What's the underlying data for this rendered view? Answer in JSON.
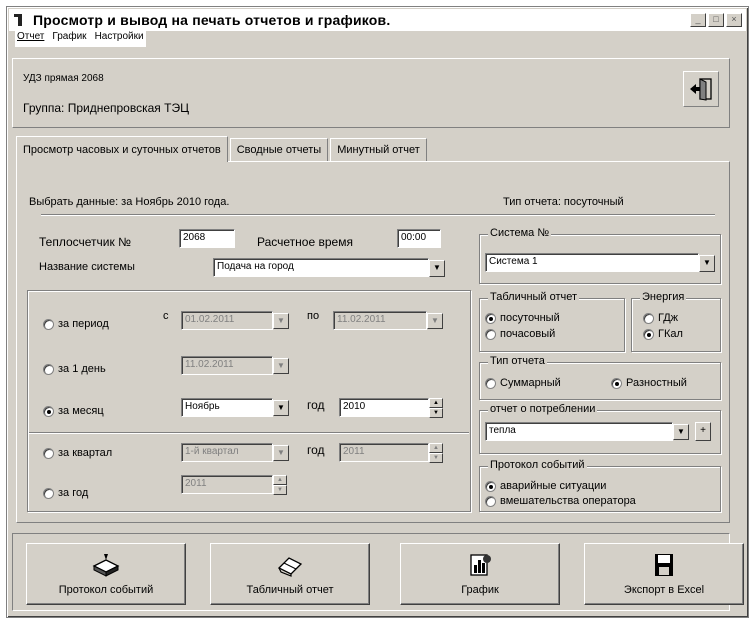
{
  "window": {
    "title": "Просмотр и вывод на печать отчетов и графиков.",
    "controls": [
      "_",
      "□",
      "×"
    ]
  },
  "menu": [
    "Отчет",
    "График",
    "Настройки"
  ],
  "info": {
    "line1": "УДЗ прямая 2068",
    "line2": "Группа: Приднепровская ТЭЦ"
  },
  "tabs": [
    "Просмотр часовых и суточных отчетов",
    "Сводные отчеты",
    "Минутный отчет"
  ],
  "main": {
    "period_text": "Выбрать данные: за Ноябрь 2010 года.",
    "report_type_text": "Тип отчета: посуточный",
    "meter_label": "Теплосчетчик №",
    "meter_value": "2068",
    "calc_time_label": "Расчетное время",
    "calc_time_value": "00:00",
    "system_name_label": "Название системы",
    "system_name_value": "Подача на город",
    "combo_arrow": "▼",
    "period": {
      "label": "за период",
      "from_label": "с",
      "from_value": "01.02.2011",
      "to_label": "по",
      "to_value": "11.02.2011"
    },
    "day": {
      "label": "за 1 день",
      "value": "11.02.2011"
    },
    "month": {
      "label": "за месяц",
      "value": "Ноябрь",
      "year_label": "год",
      "year_value": "2010"
    },
    "quarter": {
      "label": "за квартал",
      "value": "1-й квартал",
      "year_label": "год",
      "year_value": "2011"
    },
    "year": {
      "label": "за год",
      "value": "2011"
    }
  },
  "right": {
    "system_group_title": "Система №",
    "system_value": "Система 1",
    "table_report_title": "Табличный отчет",
    "table_report_options": [
      "посуточный",
      "почасовый"
    ],
    "energy_title": "Энергия",
    "energy_options": [
      "ГДж",
      "ГКал"
    ],
    "report_type_title": "Тип отчета",
    "report_type_options": [
      "Суммарный",
      "Разностный"
    ],
    "consumption_title": "отчет о потреблении",
    "consumption_value": "тепла",
    "plus_label": "+",
    "events_title": "Протокол событий",
    "events_options": [
      "аварийные ситуации",
      "вмешательства оператора"
    ]
  },
  "buttons": {
    "events": "Протокол событий",
    "table": "Табличный отчет",
    "graph": "График",
    "excel": "Экспорт в Excel"
  }
}
